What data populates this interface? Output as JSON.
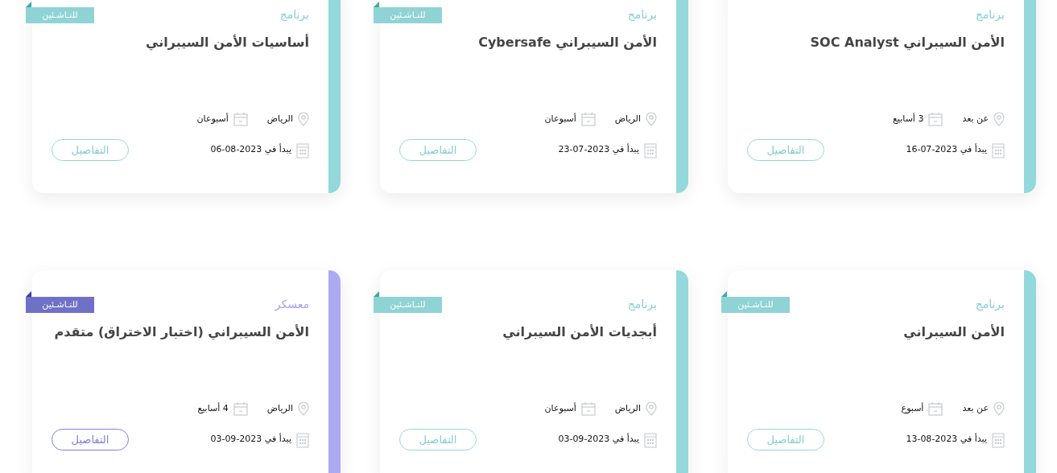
{
  "cards": [
    {
      "kind": "program",
      "color": "#93d8da",
      "category": "برنامج",
      "title": "الأمن السيبراني SOC Analyst",
      "location": "عن بعد",
      "duration": "3 أسابيع",
      "start": "يبدأ في 2023-07-16",
      "button": "التفاصيل"
    },
    {
      "kind": "program",
      "color": "#93d8da",
      "badge": "للنـاشـئين",
      "category": "برنامج",
      "title": "الأمن السيبراني Cybersafe",
      "location": "الرياض",
      "duration": "أسبوعان",
      "start": "يبدأ في 2023-07-23",
      "button": "التفاصيل"
    },
    {
      "kind": "program",
      "color": "#93d8da",
      "badge": "للنـاشـئين",
      "category": "برنامج",
      "title": "أساسيات الأمن السيبراني",
      "location": "الرياض",
      "duration": "أسبوعان",
      "start": "يبدأ في 2023-08-06",
      "button": "التفاصيل"
    },
    {
      "kind": "program",
      "color": "#93d8da",
      "badge": "للنـاشـئين",
      "category": "برنامج",
      "title": "الأمن السيبراني",
      "location": "عن بعد",
      "duration": "أسبوع",
      "start": "يبدأ في 2023-08-13",
      "button": "التفاصيل"
    },
    {
      "kind": "program",
      "color": "#93d8da",
      "badge": "للنـاشـئين",
      "category": "برنامج",
      "title": "أبجديات الأمن السيبراني",
      "location": "الرياض",
      "duration": "أسبوعان",
      "start": "يبدأ في 2023-09-03",
      "button": "التفاصيل"
    },
    {
      "kind": "camp",
      "color": "#abaaf2",
      "badge": "للنـاشـئين",
      "category": "معسكر",
      "title": "الأمن السيبراني (اختبار الاختراق) متقدم",
      "location": "الرياض",
      "duration": "4 أسابيع",
      "start": "يبدأ في 2023-09-03",
      "button": "التفاصيل"
    }
  ]
}
